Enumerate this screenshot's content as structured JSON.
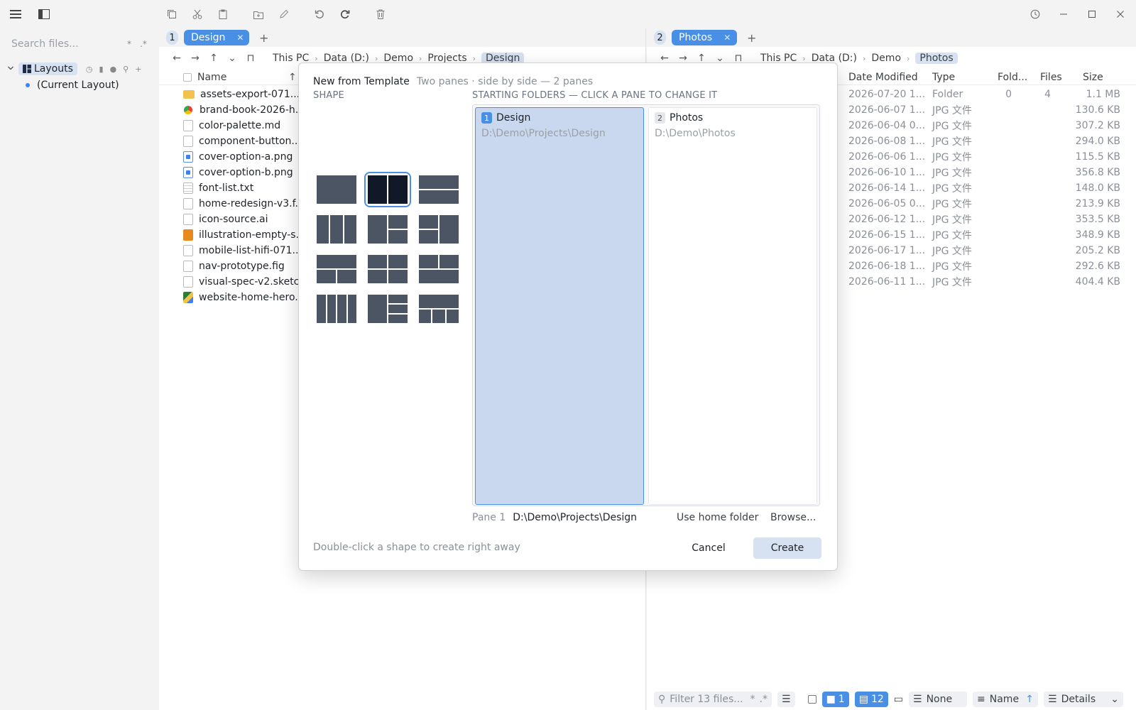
{
  "sidebar": {
    "search_placeholder": "Search files...",
    "search_opt1": "*",
    "search_opt2": ".*",
    "layouts_label": "Layouts",
    "current_layout": "(Current Layout)"
  },
  "pane1": {
    "number": "1",
    "tab_label": "Design",
    "crumbs": [
      "This PC",
      "Data (D:)",
      "Demo",
      "Projects",
      "Design"
    ],
    "col_name": "Name",
    "files": [
      {
        "name": "assets-export-071...",
        "icon": "folder"
      },
      {
        "name": "brand-book-2026-h...",
        "icon": "chrome"
      },
      {
        "name": "color-palette.md",
        "icon": "doc"
      },
      {
        "name": "component-button...",
        "icon": "doc"
      },
      {
        "name": "cover-option-a.png",
        "icon": "img"
      },
      {
        "name": "cover-option-b.png",
        "icon": "img"
      },
      {
        "name": "font-list.txt",
        "icon": "txt"
      },
      {
        "name": "home-redesign-v3.f...",
        "icon": "doc"
      },
      {
        "name": "icon-source.ai",
        "icon": "doc"
      },
      {
        "name": "illustration-empty-s...",
        "icon": "sketch"
      },
      {
        "name": "mobile-list-hifi-071...",
        "icon": "doc"
      },
      {
        "name": "nav-prototype.fig",
        "icon": "doc"
      },
      {
        "name": "visual-spec-v2.sketch",
        "icon": "doc"
      },
      {
        "name": "website-home-hero...",
        "icon": "ps"
      }
    ]
  },
  "pane2": {
    "number": "2",
    "tab_label": "Photos",
    "crumbs": [
      "This PC",
      "Data (D:)",
      "Demo",
      "Photos"
    ],
    "columns": {
      "date": "Date Modified",
      "type": "Type",
      "folders": "Fold...",
      "files": "Files",
      "size": "Size"
    },
    "rows": [
      {
        "date": "2026-07-20 1...",
        "type": "Folder",
        "folders": "0",
        "files": "4",
        "size": "1.1 MB"
      },
      {
        "date": "2026-06-07 1...",
        "type": "JPG 文件",
        "folders": "",
        "files": "",
        "size": "130.6 KB"
      },
      {
        "date": "2026-06-04 0...",
        "type": "JPG 文件",
        "folders": "",
        "files": "",
        "size": "307.2 KB"
      },
      {
        "date": "2026-06-08 1...",
        "type": "JPG 文件",
        "folders": "",
        "files": "",
        "size": "294.0 KB"
      },
      {
        "date": "2026-06-06 1...",
        "type": "JPG 文件",
        "folders": "",
        "files": "",
        "size": "115.5 KB"
      },
      {
        "date": "2026-06-10 1...",
        "type": "JPG 文件",
        "folders": "",
        "files": "",
        "size": "356.8 KB"
      },
      {
        "date": "2026-06-14 1...",
        "type": "JPG 文件",
        "folders": "",
        "files": "",
        "size": "148.0 KB"
      },
      {
        "date": "2026-06-05 0...",
        "type": "JPG 文件",
        "folders": "",
        "files": "",
        "size": "213.9 KB"
      },
      {
        "date": "2026-06-12 1...",
        "type": "JPG 文件",
        "folders": "",
        "files": "",
        "size": "353.5 KB"
      },
      {
        "date": "2026-06-15 1...",
        "type": "JPG 文件",
        "folders": "",
        "files": "",
        "size": "348.9 KB"
      },
      {
        "date": "2026-06-17 1...",
        "type": "JPG 文件",
        "folders": "",
        "files": "",
        "size": "205.2 KB"
      },
      {
        "date": "2026-06-18 1...",
        "type": "JPG 文件",
        "folders": "",
        "files": "",
        "size": "292.6 KB"
      },
      {
        "date": "2026-06-11 1...",
        "type": "JPG 文件",
        "folders": "",
        "files": "",
        "size": "404.4 KB"
      }
    ],
    "status": {
      "filter_placeholder": "Filter 13 files...",
      "opt1": "*",
      "opt2": ".*",
      "folder_count": "1",
      "file_count": "12",
      "group": "None",
      "sort": "Name",
      "view": "Details"
    }
  },
  "modal": {
    "title": "New from Template",
    "subtitle": "Two panes · side by side — 2 panes",
    "shape_label": "SHAPE",
    "folders_label": "STARTING FOLDERS — CLICK A PANE TO CHANGE IT",
    "panes": [
      {
        "num": "1",
        "name": "Design",
        "path": "D:\\Demo\\Projects\\Design"
      },
      {
        "num": "2",
        "name": "Photos",
        "path": "D:\\Demo\\Photos"
      }
    ],
    "pane_field_label": "Pane 1",
    "pane_field_value": "D:\\Demo\\Projects\\Design",
    "use_home": "Use home folder",
    "browse": "Browse...",
    "hint": "Double-click a shape to create right away",
    "cancel": "Cancel",
    "create": "Create"
  },
  "colors": {
    "accent": "#4a8fe6",
    "selection": "#c9d8ef",
    "pill": "#d6e2f2"
  }
}
